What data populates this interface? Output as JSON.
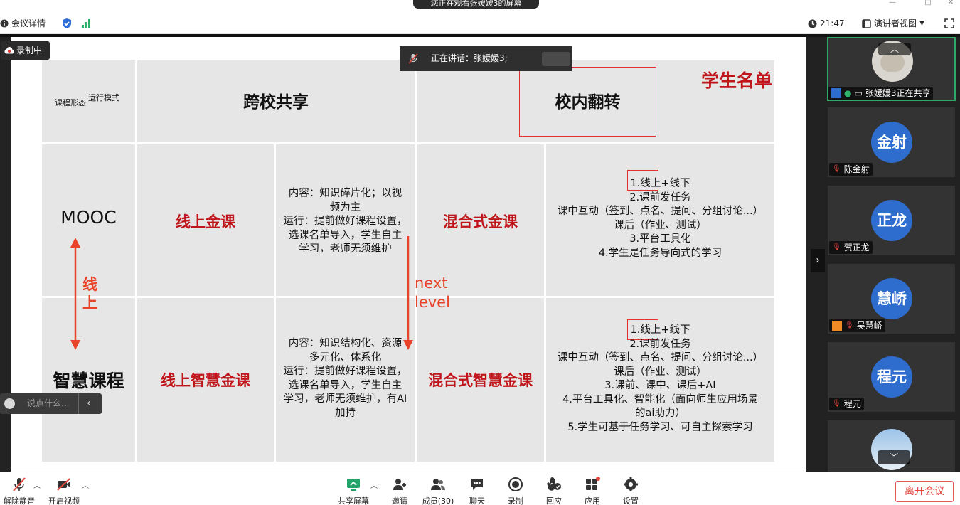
{
  "window": {
    "share_banner": "您正在观看张嫒嫒3的屏幕",
    "meeting_info": "会议详情",
    "time": "21:47",
    "view_mode": "演讲者视图"
  },
  "recording": {
    "label": "录制中"
  },
  "speaker": {
    "label": "正在讲话：张嫒嫒3;"
  },
  "chat": {
    "placeholder": "说点什么..."
  },
  "slide": {
    "header_form": "课程形态",
    "header_mode": "运行模式",
    "col_shared": "跨校共享",
    "col_flip": "校内翻转",
    "student_list": "学生名单",
    "row1_label": "MOOC",
    "row2_label": "智慧课程",
    "arrow_text_line1": "线",
    "arrow_text_line2": "上",
    "next_level_1": "next",
    "next_level_2": "level",
    "r1_shared_title": "线上金课",
    "r1_shared_desc": [
      "内容：知识碎片化；以视",
      "频为主",
      "运行：提前做好课程设置，",
      "选课名单导入，学生自主",
      "学习，老师无须维护"
    ],
    "r1_flip_title": "混合式金课",
    "r1_flip_desc": [
      "1.线上+线下",
      "2.课前发任务",
      "课中互动（签到、点名、提问、分组讨论...）",
      "课后（作业、测试）",
      "3.平台工具化",
      "4.学生是任务导向式的学习"
    ],
    "r2_shared_title": "线上智慧金课",
    "r2_shared_desc": [
      "内容：知识结构化、资源",
      "多元化、体系化",
      "运行：提前做好课程设置，",
      "选课名单导入，学生自主",
      "学习，老师无须维护，有AI",
      "加持"
    ],
    "r2_flip_title": "混合式智慧金课",
    "r2_flip_desc": [
      "1.线上+线下",
      "2.课前发任务",
      "课中互动（签到、点名、提问、分组讨论...）",
      "课后（作业、测试）",
      "3.课前、课中、课后+AI",
      "4.平台工具化、智能化（面向师生应用场景",
      "的ai助力）",
      "5.学生可基于任务学习、可自主探索学习"
    ]
  },
  "participants": [
    {
      "name": "张嫒嫒3正在共享",
      "avatar": "",
      "photo": true
    },
    {
      "name": "陈金射",
      "avatar": "金射"
    },
    {
      "name": "贺正龙",
      "avatar": "正龙"
    },
    {
      "name": "吴慧峤",
      "avatar": "慧峤"
    },
    {
      "name": "程元",
      "avatar": "程元"
    }
  ],
  "bottom": {
    "unmute": "解除静音",
    "video": "开启视频",
    "share": "共享屏幕",
    "invite": "邀请",
    "members": "成员(30)",
    "chat": "聊天",
    "record": "录制",
    "reaction": "回应",
    "apps": "应用",
    "settings": "设置",
    "leave": "离开会议"
  },
  "colors": {
    "accent_red": "#c0151b",
    "avatar_blue": "#2e6ccd",
    "active_green": "#2ea96a"
  }
}
